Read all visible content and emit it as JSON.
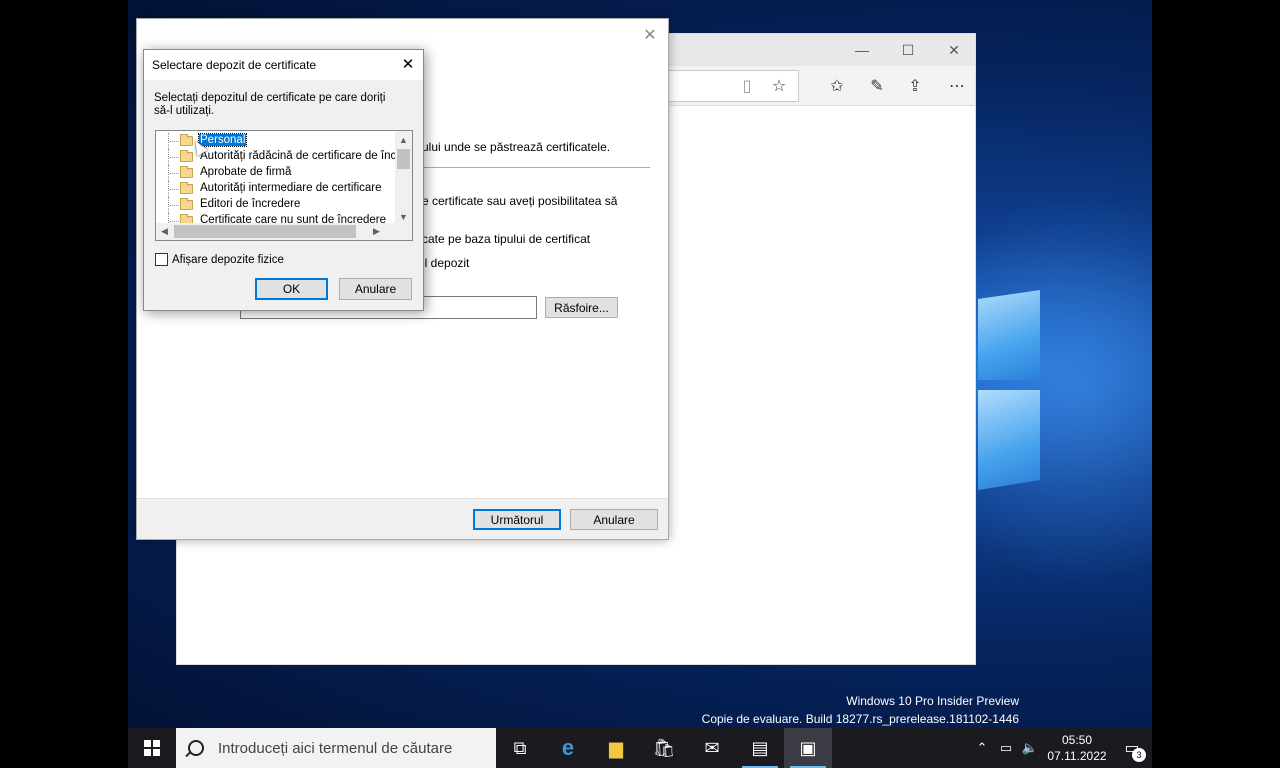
{
  "watermark": {
    "line1": "Windows 10 Pro Insider Preview",
    "line2": "Copie de evaluare. Build 18277.rs_prerelease.181102-1446"
  },
  "edge": {
    "controls": {
      "minimize": "—",
      "maximize": "☐",
      "close": "✕"
    },
    "toolbar_icons": [
      "reading-view-icon",
      "favorite-star-icon",
      "favorites-hub-icon",
      "pen-notes-icon",
      "share-icon",
      "more-icon"
    ]
  },
  "wizard": {
    "text_store_location": "ului unde se păstrează certificatele.",
    "text_auto_select": "e certificate sau aveți posibilitatea să",
    "text_radio_auto": "cate pe baza tipului de certificat",
    "text_radio_manual": "il depozit",
    "browse_label": "Răsfoire...",
    "next_label": "Următorul",
    "cancel_label": "Anulare",
    "close_glyph": "✕"
  },
  "dialog": {
    "title": "Selectare depozit de certificate",
    "close_glyph": "✕",
    "description": "Selectați depozitul de certificate pe care doriți să-l utilizați.",
    "tree_items": [
      "Personal",
      "Autorități rădăcină de certificare de încre",
      "Aprobate de firmă",
      "Autorități intermediare de certificare",
      "Editori de încredere",
      "Certificate care nu sunt de încredere"
    ],
    "selected_index": 0,
    "show_physical_label": "Afișare depozite fizice",
    "show_physical_checked": false,
    "ok_label": "OK",
    "cancel_label": "Anulare"
  },
  "taskbar": {
    "search_placeholder": "Introduceți aici termenul de căutare",
    "time": "05:50",
    "date": "07.11.2022",
    "notification_count": "3"
  }
}
